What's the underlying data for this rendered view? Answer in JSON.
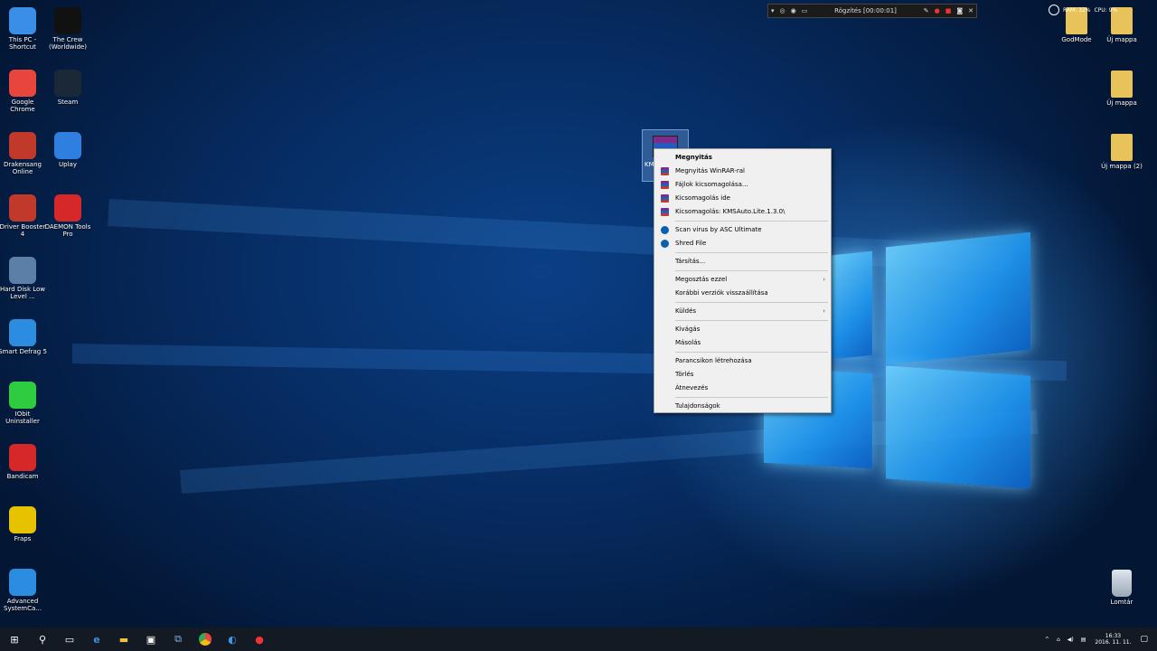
{
  "desktop_icons_left": [
    {
      "label": "This PC - Shortcut",
      "icon": "computer-icon",
      "color": "#3a8ee6"
    },
    {
      "label": "Google Chrome",
      "icon": "chrome-icon",
      "color": "#e8453c"
    },
    {
      "label": "Drakensang Online",
      "icon": "drakensang-icon",
      "color": "#c0392b"
    },
    {
      "label": "Driver Booster 4",
      "icon": "driver-booster-icon",
      "color": "#c0392b"
    },
    {
      "label": "Hard Disk Low Level ...",
      "icon": "harddisk-icon",
      "color": "#5c7fa8"
    },
    {
      "label": "Smart Defrag 5",
      "icon": "defrag-icon",
      "color": "#2c8de0"
    },
    {
      "label": "IObit Uninstaller",
      "icon": "uninstaller-icon",
      "color": "#2ecc40"
    },
    {
      "label": "Bandicam",
      "icon": "bandicam-icon",
      "color": "#d62828"
    },
    {
      "label": "Fraps",
      "icon": "fraps-icon",
      "color": "#e6c200"
    },
    {
      "label": "Advanced SystemCa...",
      "icon": "systemcare-icon",
      "color": "#2c8de0"
    }
  ],
  "desktop_icons_col2": [
    {
      "label": "The Crew (Worldwide)",
      "icon": "thecrew-icon",
      "color": "#111111"
    },
    {
      "label": "Steam",
      "icon": "steam-icon",
      "color": "#1b2838"
    },
    {
      "label": "Uplay",
      "icon": "uplay-icon",
      "color": "#2f7fe0"
    },
    {
      "label": "DAEMON Tools Pro",
      "icon": "daemon-tools-icon",
      "color": "#d62828"
    }
  ],
  "desktop_icons_right": [
    {
      "label": "GodMode",
      "icon": "folder-icon"
    },
    {
      "label": "Új mappa",
      "icon": "folder-icon"
    },
    {
      "label": "Új mappa",
      "icon": "folder-icon"
    },
    {
      "label": "Új mappa (2)",
      "icon": "folder-icon"
    },
    {
      "label": "Lomtár",
      "icon": "recycle-bin-icon"
    }
  ],
  "selected_file": {
    "label": "KMS",
    "icon": "rar-archive-icon"
  },
  "recording_toolbar": {
    "status": "Rögzítés [00:00:01]"
  },
  "system_monitor": {
    "ram": "RAM: 32%",
    "cpu": "CPU: 9%"
  },
  "context_menu": {
    "groups": [
      [
        {
          "label": "Megnyitás",
          "bold": true,
          "icon": null
        },
        {
          "label": "Megnyitás WinRAR-ral",
          "icon": "winrar-icon"
        },
        {
          "label": "Fájlok kicsomagolása...",
          "icon": "winrar-icon"
        },
        {
          "label": "Kicsomagolás ide",
          "icon": "winrar-icon"
        },
        {
          "label": "Kicsomagolás: KMSAuto.Lite.1.3.0\\",
          "icon": "winrar-icon"
        }
      ],
      [
        {
          "label": "Scan virus by ASC Ultimate",
          "icon": "asc-icon"
        },
        {
          "label": "Shred File",
          "icon": "asc-icon"
        }
      ],
      [
        {
          "label": "Társítás...",
          "icon": null
        }
      ],
      [
        {
          "label": "Megosztás ezzel",
          "icon": null,
          "submenu": true
        },
        {
          "label": "Korábbi verziók visszaállítása",
          "icon": null
        }
      ],
      [
        {
          "label": "Küldés",
          "icon": null,
          "submenu": true
        }
      ],
      [
        {
          "label": "Kivágás",
          "icon": null
        },
        {
          "label": "Másolás",
          "icon": null
        }
      ],
      [
        {
          "label": "Parancsikon létrehozása",
          "icon": null
        },
        {
          "label": "Törlés",
          "icon": null
        },
        {
          "label": "Átnevezés",
          "icon": null
        }
      ],
      [
        {
          "label": "Tulajdonságok",
          "icon": null
        }
      ]
    ]
  },
  "taskbar": {
    "items": [
      "start-icon",
      "search-icon",
      "task-view-icon",
      "edge-icon",
      "file-explorer-icon",
      "store-icon",
      "network-app-icon",
      "chrome-icon",
      "systemcare-icon",
      "bandicam-icon"
    ],
    "clock_time": "16:33",
    "clock_date": "2016. 11. 11."
  }
}
